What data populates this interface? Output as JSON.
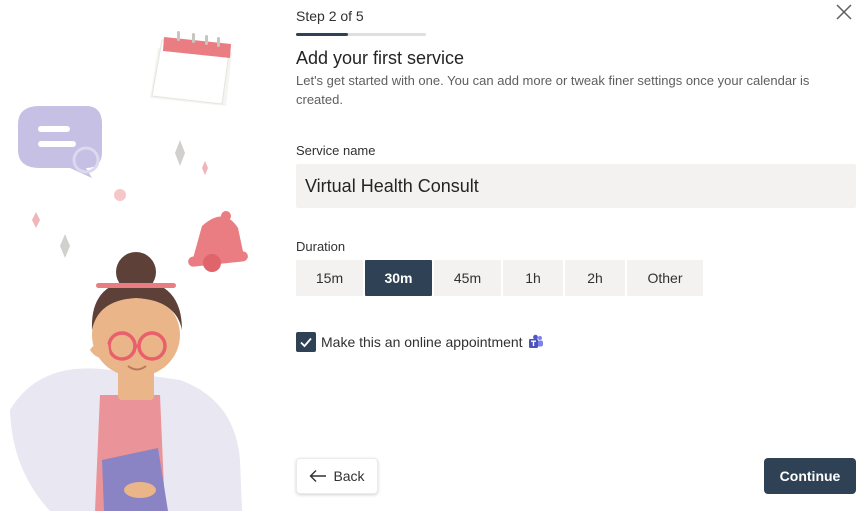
{
  "wizard": {
    "step_text": "Step 2 of 5",
    "progress_fraction": 0.4,
    "title": "Add your first service",
    "description": "Let's get started with one. You can add more or tweak finer settings once your calendar is created."
  },
  "service_name": {
    "label": "Service name",
    "value": "Virtual Health Consult"
  },
  "duration": {
    "label": "Duration",
    "options": [
      "15m",
      "30m",
      "45m",
      "1h",
      "2h",
      "Other"
    ],
    "selected": "30m"
  },
  "online_appointment": {
    "checked": true,
    "label": "Make this an online appointment",
    "icon": "teams-icon"
  },
  "footer": {
    "back_label": "Back",
    "continue_label": "Continue"
  },
  "colors": {
    "accent": "#2f4255",
    "input_bg": "#f3f2f1",
    "illustration_pink": "#ea7d82",
    "illustration_lavender": "#c5c0e4"
  },
  "icons": {
    "close": "close-icon",
    "back": "arrow-left-icon",
    "checkbox": "checkmark-icon"
  }
}
